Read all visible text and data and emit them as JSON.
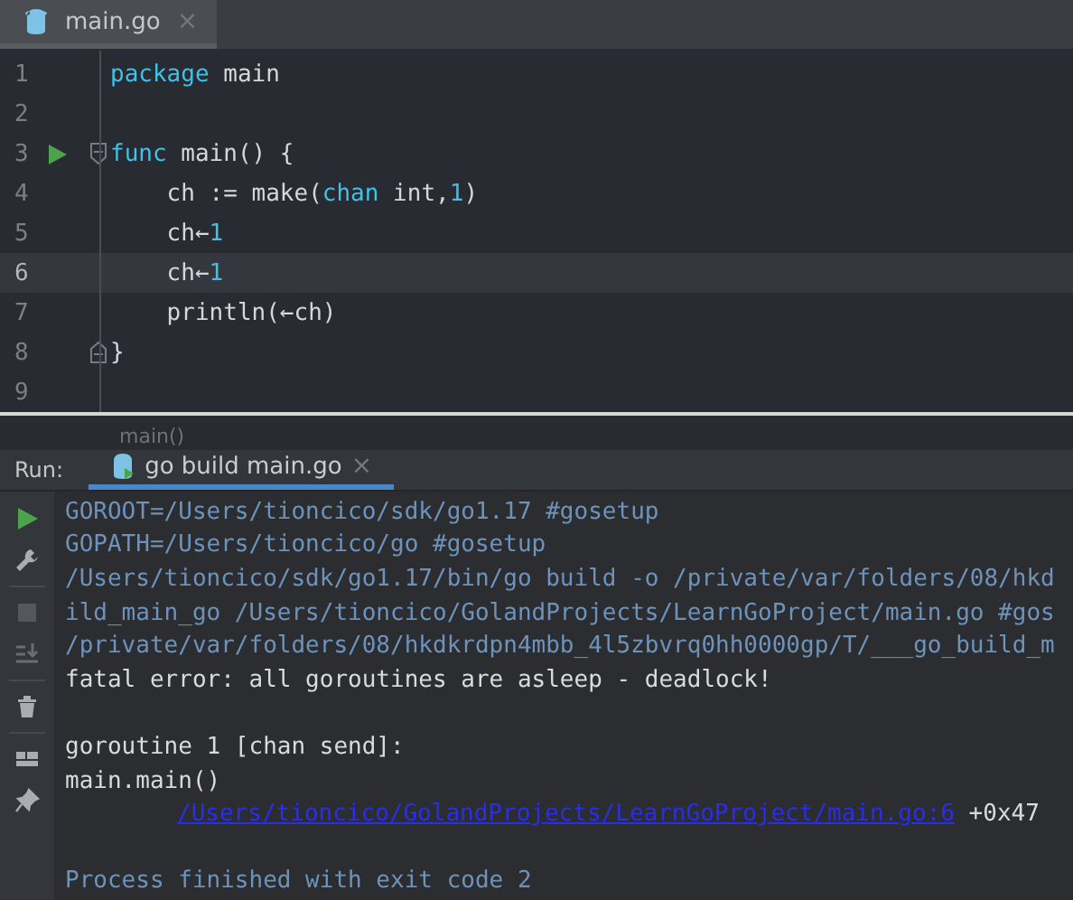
{
  "editor_tabs": [
    {
      "label": "main.go",
      "close": "×",
      "selected": true
    }
  ],
  "code_lines": [
    {
      "number": "1",
      "current": false,
      "run_marker": false,
      "fold_start": false,
      "fold_end": false,
      "segments": [
        {
          "kind": "keyword",
          "text": "package"
        },
        {
          "kind": "text",
          "text": " main"
        }
      ]
    },
    {
      "number": "2",
      "current": false,
      "run_marker": false,
      "fold_start": false,
      "fold_end": false
    },
    {
      "number": "3",
      "current": false,
      "run_marker": true,
      "fold_start": true,
      "fold_end": false,
      "segments": [
        {
          "kind": "keyword",
          "text": "func"
        },
        {
          "kind": "text",
          "text": " main() {"
        }
      ]
    },
    {
      "number": "4",
      "current": false,
      "run_marker": false,
      "fold_start": false,
      "fold_end": false,
      "segments": [
        {
          "kind": "text",
          "text": "    ch := make("
        },
        {
          "kind": "keyword",
          "text": "chan"
        },
        {
          "kind": "text",
          "text": " int,"
        },
        {
          "kind": "number",
          "text": "1"
        },
        {
          "kind": "text",
          "text": ")"
        }
      ]
    },
    {
      "number": "5",
      "current": false,
      "run_marker": false,
      "fold_start": false,
      "fold_end": false,
      "segments": [
        {
          "kind": "text",
          "text": "    ch←"
        },
        {
          "kind": "number",
          "text": "1"
        }
      ]
    },
    {
      "number": "6",
      "current": true,
      "run_marker": false,
      "fold_start": false,
      "fold_end": false,
      "segments": [
        {
          "kind": "text",
          "text": "    ch←"
        },
        {
          "kind": "number",
          "text": "1"
        }
      ]
    },
    {
      "number": "7",
      "current": false,
      "run_marker": false,
      "fold_start": false,
      "fold_end": false,
      "segments": [
        {
          "kind": "text",
          "text": "    println(←ch)"
        }
      ]
    },
    {
      "number": "8",
      "current": false,
      "run_marker": false,
      "fold_start": false,
      "fold_end": true,
      "segments": [
        {
          "kind": "text",
          "text": "}"
        }
      ]
    },
    {
      "number": "9",
      "current": false,
      "run_marker": false,
      "fold_start": false,
      "fold_end": false
    }
  ],
  "breadcrumb": "main()",
  "run_panel": {
    "label": "Run:",
    "tabs": [
      {
        "label": "go build main.go",
        "close": "×",
        "selected": true
      }
    ],
    "tools": [
      {
        "kind": "run",
        "disabled": false
      },
      {
        "kind": "settings",
        "disabled": false
      },
      {
        "kind": "stop",
        "disabled": true
      },
      {
        "kind": "scroll",
        "disabled": true
      },
      {
        "kind": "trash",
        "disabled": false
      },
      {
        "kind": "layout",
        "disabled": false
      },
      {
        "kind": "pin",
        "disabled": false
      }
    ],
    "console": [
      {
        "kind": "info",
        "text": "GOROOT=/Users/tioncico/sdk/go1.17 #gosetup"
      },
      {
        "kind": "info",
        "text": "GOPATH=/Users/tioncico/go #gosetup"
      },
      {
        "kind": "info",
        "text": "/Users/tioncico/sdk/go1.17/bin/go build -o /private/var/folders/08/hkd"
      },
      {
        "kind": "info",
        "text": "ild_main_go /Users/tioncico/GolandProjects/LearnGoProject/main.go #gos"
      },
      {
        "kind": "info",
        "text": "/private/var/folders/08/hkdkrdpn4mbb_4l5zbvrq0hh0000gp/T/___go_build_m"
      },
      {
        "kind": "output",
        "text": "fatal error: all goroutines are asleep - deadlock!"
      },
      {
        "kind": "blank"
      },
      {
        "kind": "output",
        "text": "goroutine 1 [chan send]:"
      },
      {
        "kind": "output",
        "text": "main.main()"
      },
      {
        "kind": "trace",
        "link": "/Users/tioncico/GolandProjects/LearnGoProject/main.go:6",
        "text": "+0x47"
      },
      {
        "kind": "blank"
      },
      {
        "kind": "info",
        "text": "Process finished with exit code 2"
      }
    ]
  }
}
